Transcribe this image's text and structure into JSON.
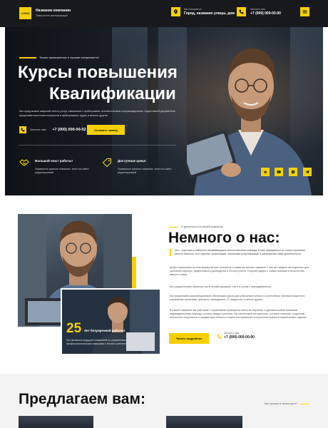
{
  "header": {
    "logo": "LOGO",
    "company_name": "Название компании",
    "company_sub": "Повышение квалификации",
    "address_caption": "Мы находимся:",
    "address_value": "Город, название улицы, дом",
    "phone_caption": "Звоните нам:",
    "phone_value": "+7 (000) 000-00-00"
  },
  "hero": {
    "tag": "Только проверенные и лучшие специалисты!",
    "title_line1": "Курсы повышения",
    "title_line2": "Квалификации",
    "description": "Мы предлагаем широкий спектр услуг, связанных с арбитражем, аналитическим сопровождением, подготовкой документов, представительством интересов в арбитражных судах и многое другое.",
    "phone_caption": "Звоните нам:",
    "phone_value": "+7 (000) 000-00-02",
    "cta": "Оставить заявку",
    "features": [
      {
        "title": "Большой опыт работы!",
        "desc": "Примерное краткое описание, текст на сайте редактируемый"
      },
      {
        "title": "Доступные цены!",
        "desc": "Примерное краткое описание, текст на сайте редактируемый"
      }
    ],
    "social_icons": [
      "vk-icon",
      "youtube-icon",
      "whatsapp-icon",
      "telegram-icon"
    ]
  },
  "about": {
    "tag": "О деятельности нашей компании",
    "title": "Немного о нас:",
    "quote": "Мы – опытная и стабильно развивающаяся консалтинговая команда. К нам обращаются не только компании малого бизнеса, но и крупные организации, слияниями реорганизации и расширения сфер деятельности.",
    "p1": "Добро пожаловать на платформу бизнес-тренингов и развития личных навыков! У нас вы найдете инструменты для успешной карьеры, эффективного руководства и личного роста. Откройте двери к новым знаниям и вольностям вместе с нами.",
    "p2": "Мы осуществляем обучение как в онлайн-формате, так и в очном с преподавателем.",
    "p3": "Мы предлагаем широкий диапазон обучающих курсов для улучшения личных и когнитивных, включая маркетинг, управление проектами, финансы, менеджмент, IT, лидерство и многое другое.",
    "p4": "В нашей компании мы работаем с охраняемым принципом качества обучения и уделяем особое внимание индивидуальному подходу к успеху каждого ученика. Мы используем методологии, которые помогают студентам полностью погрузиться в предметную область и научиться применять полученные знания в практических задачах.",
    "experience_number": "25",
    "experience_label": "Лет безупречной работы!",
    "experience_desc": "Мы являемся ведущей компанией по управлению профессиональными навыками и бизнес-тренингам.",
    "cta": "Читать подробнее",
    "phone_caption": "Звоните нам:",
    "phone_value": "+7 (000) 000-00-00"
  },
  "offer": {
    "title": "Предлагаем вам:",
    "note": "Мы лучшие в своем деле!"
  },
  "colors": {
    "accent": "#f5d000",
    "dark": "#17191c",
    "light_bg": "#f3f3f3"
  }
}
